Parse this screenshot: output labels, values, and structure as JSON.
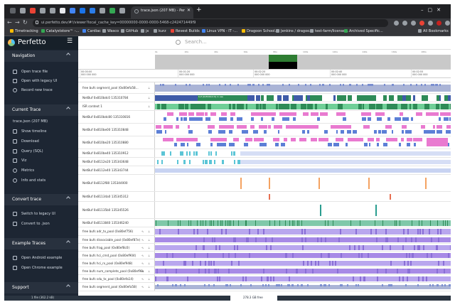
{
  "browser": {
    "active_tab_title": "trace.json (207 MB) - Perfetto",
    "url": "ui.perfetto.dev/#!/viewer?local_cache_key=00000000-0000-0000-5468-c242471449f9",
    "bookmarks": [
      "Timetracking",
      "Catalyststore™ -...",
      "Cardiac",
      "Wasco",
      "GitHub",
      "jx",
      "kurz",
      "Revest Builds",
      "Linux VPN - IT -...",
      "Dragoon School...",
      "Jenkins / dragoo...",
      "test-farm/license...",
      "Archived Specific..."
    ],
    "all_bookmarks_label": "All Bookmarks"
  },
  "app": {
    "title": "Perfetto",
    "search_placeholder": "Search..."
  },
  "sidebar": {
    "sections": [
      {
        "title": "Navigation",
        "items": [
          "Open trace file",
          "Open with legacy UI",
          "Record new trace"
        ]
      },
      {
        "title": "Current Trace",
        "items": [
          "trace.json (207 MB)",
          "Show timeline",
          "Download",
          "Query (SQL)",
          "Viz",
          "Metrics",
          "Info and stats"
        ]
      },
      {
        "title": "Convert trace",
        "items": [
          "Switch to legacy UI",
          "Convert to .json"
        ]
      },
      {
        "title": "Example Traces",
        "items": [
          "Open Android example",
          "Open Chrome example"
        ]
      },
      {
        "title": "Support",
        "items": []
      }
    ]
  },
  "timeline": {
    "overview_ticks": [
      "0s",
      "20s",
      "40s",
      "60s",
      "80s",
      "100s",
      "120s",
      "140s",
      "160s",
      "180s"
    ],
    "ts_labels": [
      {
        "a": "00:00:00",
        "b": "000 000 000"
      },
      {
        "a": "00:01:20",
        "b": "000 000 000"
      },
      {
        "a": "00:02:20",
        "b": "000 000 000"
      },
      {
        "a": "00:02:40",
        "b": "000 000 000"
      },
      {
        "a": "00:02:55",
        "b": "000 000 000"
      }
    ],
    "tracks": [
      {
        "name": "free bufs segment_pool (0x80efa58...",
        "icons": true
      },
      {
        "name": "NetBuf 0x810bdc0 135310784",
        "slice_label": "buf [0x810bdc0] in use"
      },
      {
        "name": "ISR context 1"
      },
      {
        "name": "NetBuf 0x810bdc80 135310816"
      },
      {
        "name": "NetBuf 0x810be00 135310848"
      },
      {
        "name": "NetBuf 0x810be20 135310880"
      },
      {
        "name": "NetBuf 0x810be40 135310912"
      },
      {
        "name": "NetBuf 0x8112e20 135343648"
      },
      {
        "name": "NetBuf 0x8112e40 135343744"
      },
      {
        "name": "NetBuf 0x8112f80 135344000"
      },
      {
        "name": "NetBuf 0x81134a0 135345312"
      },
      {
        "name": "NetBuf 0x81135b0 135345526"
      },
      {
        "name": "NetBuf 0x8113840 135346240"
      },
      {
        "name": "free bufs adr_tx_pool (0x80ef756)"
      },
      {
        "name": "free bufs dissociable_pool (0x80ef87e)"
      },
      {
        "name": "free bufs frag_pool (0x80ef8c0)"
      },
      {
        "name": "free bufs hci_cmd_pool (0x80ef904)"
      },
      {
        "name": "free bufs hci_rx_pool (0x80ef948)"
      },
      {
        "name": "free bufs num_complete_pool (0x80ef98c)"
      },
      {
        "name": "free bufs sdu_tx_pool (0x80efa14)"
      },
      {
        "name": "free bufs segment_pool (0x80efa58)"
      }
    ]
  },
  "statusbar": {
    "left": "1 file (362.2 kB)",
    "center": "278.3 GB free"
  }
}
